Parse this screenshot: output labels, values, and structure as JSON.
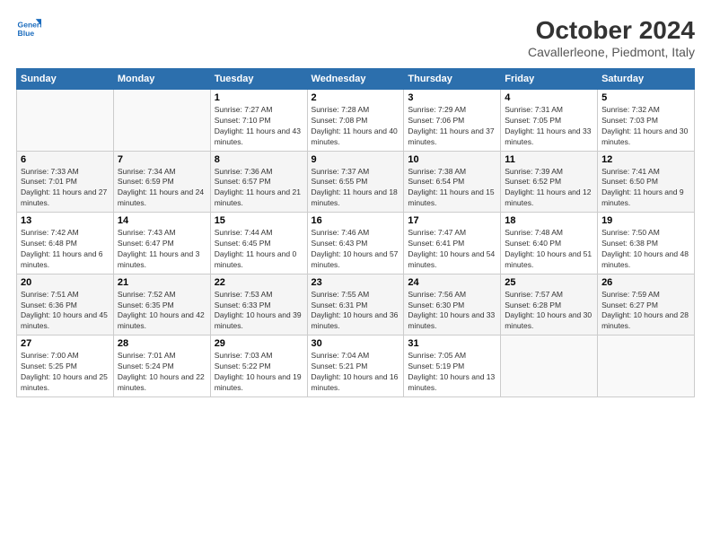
{
  "header": {
    "logo_line1": "General",
    "logo_line2": "Blue",
    "title": "October 2024",
    "subtitle": "Cavallerleone, Piedmont, Italy"
  },
  "weekdays": [
    "Sunday",
    "Monday",
    "Tuesday",
    "Wednesday",
    "Thursday",
    "Friday",
    "Saturday"
  ],
  "weeks": [
    [
      {
        "day": "",
        "info": ""
      },
      {
        "day": "",
        "info": ""
      },
      {
        "day": "1",
        "info": "Sunrise: 7:27 AM\nSunset: 7:10 PM\nDaylight: 11 hours and 43 minutes."
      },
      {
        "day": "2",
        "info": "Sunrise: 7:28 AM\nSunset: 7:08 PM\nDaylight: 11 hours and 40 minutes."
      },
      {
        "day": "3",
        "info": "Sunrise: 7:29 AM\nSunset: 7:06 PM\nDaylight: 11 hours and 37 minutes."
      },
      {
        "day": "4",
        "info": "Sunrise: 7:31 AM\nSunset: 7:05 PM\nDaylight: 11 hours and 33 minutes."
      },
      {
        "day": "5",
        "info": "Sunrise: 7:32 AM\nSunset: 7:03 PM\nDaylight: 11 hours and 30 minutes."
      }
    ],
    [
      {
        "day": "6",
        "info": "Sunrise: 7:33 AM\nSunset: 7:01 PM\nDaylight: 11 hours and 27 minutes."
      },
      {
        "day": "7",
        "info": "Sunrise: 7:34 AM\nSunset: 6:59 PM\nDaylight: 11 hours and 24 minutes."
      },
      {
        "day": "8",
        "info": "Sunrise: 7:36 AM\nSunset: 6:57 PM\nDaylight: 11 hours and 21 minutes."
      },
      {
        "day": "9",
        "info": "Sunrise: 7:37 AM\nSunset: 6:55 PM\nDaylight: 11 hours and 18 minutes."
      },
      {
        "day": "10",
        "info": "Sunrise: 7:38 AM\nSunset: 6:54 PM\nDaylight: 11 hours and 15 minutes."
      },
      {
        "day": "11",
        "info": "Sunrise: 7:39 AM\nSunset: 6:52 PM\nDaylight: 11 hours and 12 minutes."
      },
      {
        "day": "12",
        "info": "Sunrise: 7:41 AM\nSunset: 6:50 PM\nDaylight: 11 hours and 9 minutes."
      }
    ],
    [
      {
        "day": "13",
        "info": "Sunrise: 7:42 AM\nSunset: 6:48 PM\nDaylight: 11 hours and 6 minutes."
      },
      {
        "day": "14",
        "info": "Sunrise: 7:43 AM\nSunset: 6:47 PM\nDaylight: 11 hours and 3 minutes."
      },
      {
        "day": "15",
        "info": "Sunrise: 7:44 AM\nSunset: 6:45 PM\nDaylight: 11 hours and 0 minutes."
      },
      {
        "day": "16",
        "info": "Sunrise: 7:46 AM\nSunset: 6:43 PM\nDaylight: 10 hours and 57 minutes."
      },
      {
        "day": "17",
        "info": "Sunrise: 7:47 AM\nSunset: 6:41 PM\nDaylight: 10 hours and 54 minutes."
      },
      {
        "day": "18",
        "info": "Sunrise: 7:48 AM\nSunset: 6:40 PM\nDaylight: 10 hours and 51 minutes."
      },
      {
        "day": "19",
        "info": "Sunrise: 7:50 AM\nSunset: 6:38 PM\nDaylight: 10 hours and 48 minutes."
      }
    ],
    [
      {
        "day": "20",
        "info": "Sunrise: 7:51 AM\nSunset: 6:36 PM\nDaylight: 10 hours and 45 minutes."
      },
      {
        "day": "21",
        "info": "Sunrise: 7:52 AM\nSunset: 6:35 PM\nDaylight: 10 hours and 42 minutes."
      },
      {
        "day": "22",
        "info": "Sunrise: 7:53 AM\nSunset: 6:33 PM\nDaylight: 10 hours and 39 minutes."
      },
      {
        "day": "23",
        "info": "Sunrise: 7:55 AM\nSunset: 6:31 PM\nDaylight: 10 hours and 36 minutes."
      },
      {
        "day": "24",
        "info": "Sunrise: 7:56 AM\nSunset: 6:30 PM\nDaylight: 10 hours and 33 minutes."
      },
      {
        "day": "25",
        "info": "Sunrise: 7:57 AM\nSunset: 6:28 PM\nDaylight: 10 hours and 30 minutes."
      },
      {
        "day": "26",
        "info": "Sunrise: 7:59 AM\nSunset: 6:27 PM\nDaylight: 10 hours and 28 minutes."
      }
    ],
    [
      {
        "day": "27",
        "info": "Sunrise: 7:00 AM\nSunset: 5:25 PM\nDaylight: 10 hours and 25 minutes."
      },
      {
        "day": "28",
        "info": "Sunrise: 7:01 AM\nSunset: 5:24 PM\nDaylight: 10 hours and 22 minutes."
      },
      {
        "day": "29",
        "info": "Sunrise: 7:03 AM\nSunset: 5:22 PM\nDaylight: 10 hours and 19 minutes."
      },
      {
        "day": "30",
        "info": "Sunrise: 7:04 AM\nSunset: 5:21 PM\nDaylight: 10 hours and 16 minutes."
      },
      {
        "day": "31",
        "info": "Sunrise: 7:05 AM\nSunset: 5:19 PM\nDaylight: 10 hours and 13 minutes."
      },
      {
        "day": "",
        "info": ""
      },
      {
        "day": "",
        "info": ""
      }
    ]
  ]
}
